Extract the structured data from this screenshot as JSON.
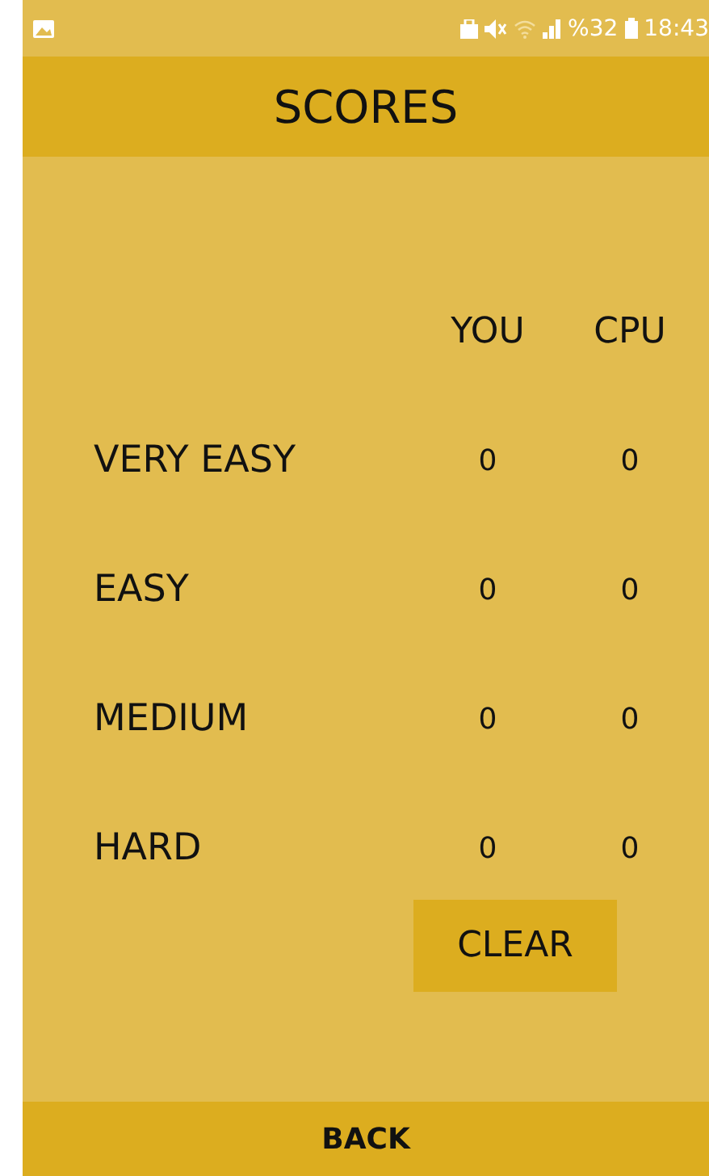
{
  "status_bar": {
    "battery_percent": "%32",
    "time": "18:43"
  },
  "header": {
    "title": "SCORES"
  },
  "table": {
    "columns": [
      "YOU",
      "CPU"
    ],
    "rows": [
      {
        "level": "VERY EASY",
        "you": "0",
        "cpu": "0"
      },
      {
        "level": "EASY",
        "you": "0",
        "cpu": "0"
      },
      {
        "level": "MEDIUM",
        "you": "0",
        "cpu": "0"
      },
      {
        "level": "HARD",
        "you": "0",
        "cpu": "0"
      }
    ]
  },
  "clear_button": "CLEAR",
  "back_button": "BACK"
}
